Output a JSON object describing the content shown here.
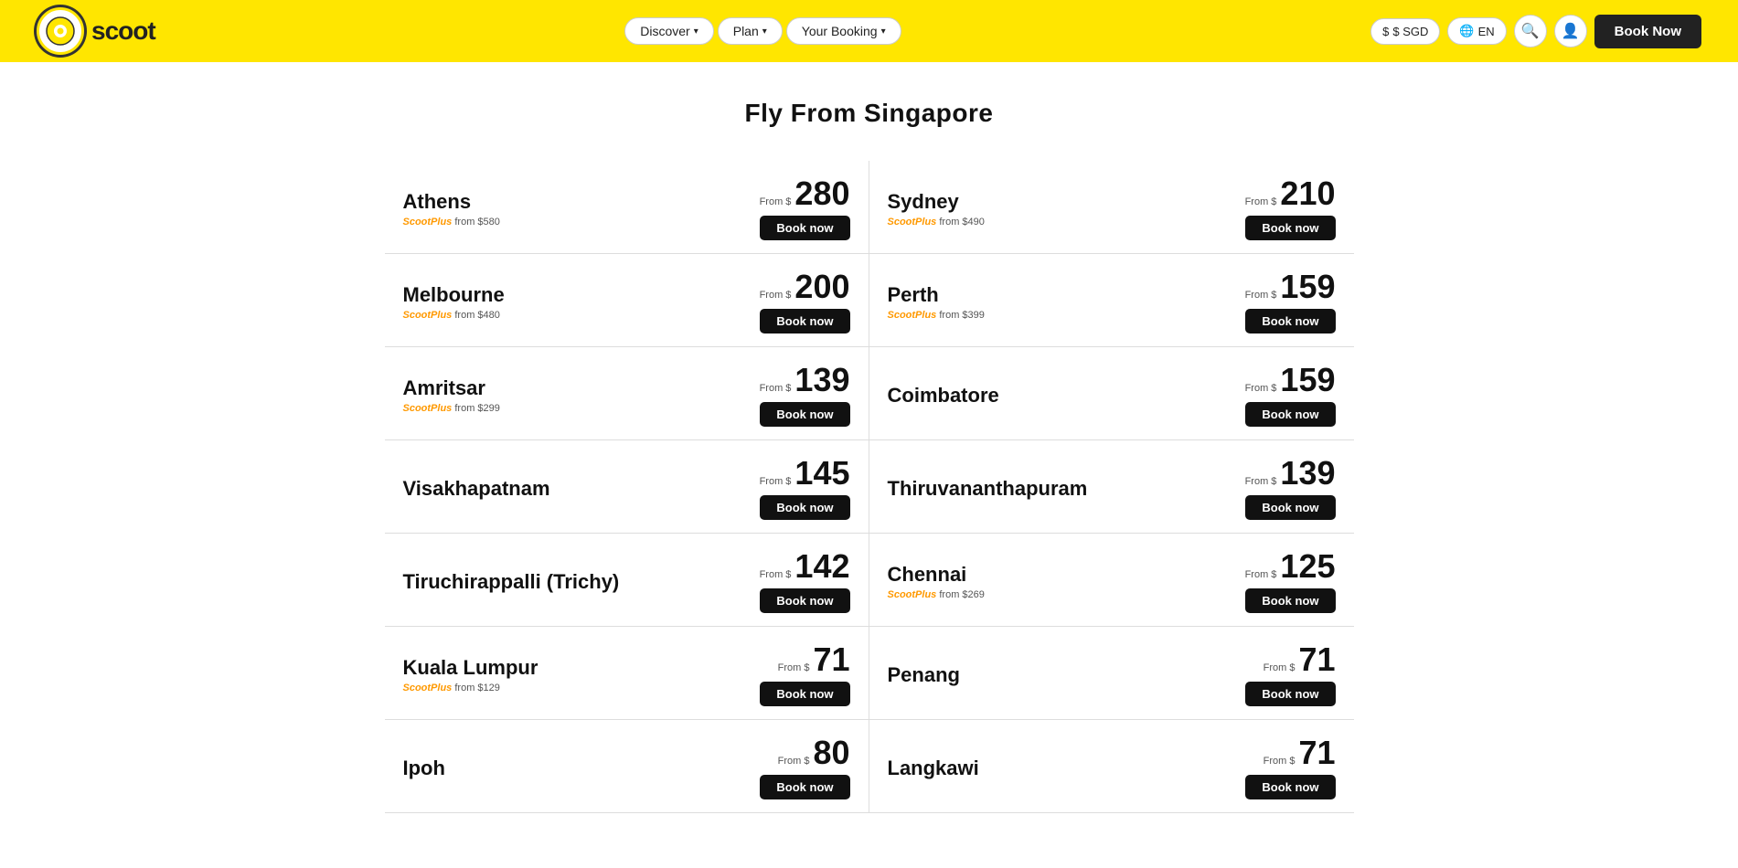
{
  "navbar": {
    "logo": "scoot",
    "nav_items": [
      {
        "label": "Discover",
        "has_arrow": true
      },
      {
        "label": "Plan",
        "has_arrow": true
      },
      {
        "label": "Your Booking",
        "has_arrow": true
      }
    ],
    "currency": "$ SGD",
    "language": "EN",
    "book_now": "Book Now"
  },
  "main": {
    "title": "Fly From Singapore",
    "destinations": [
      {
        "name": "Athens",
        "scootplus": "ScootPlus from $580",
        "from_label": "From $",
        "price": "280",
        "book_label": "Book now",
        "side": "left"
      },
      {
        "name": "Sydney",
        "scootplus": "ScootPlus from $490",
        "from_label": "From $",
        "price": "210",
        "book_label": "Book now",
        "side": "right"
      },
      {
        "name": "Melbourne",
        "scootplus": "ScootPlus from $480",
        "from_label": "From $",
        "price": "200",
        "book_label": "Book now",
        "side": "left"
      },
      {
        "name": "Perth",
        "scootplus": "ScootPlus from $399",
        "from_label": "From $",
        "price": "159",
        "book_label": "Book now",
        "side": "right"
      },
      {
        "name": "Amritsar",
        "scootplus": "ScootPlus from $299",
        "from_label": "From $",
        "price": "139",
        "book_label": "Book now",
        "side": "left"
      },
      {
        "name": "Coimbatore",
        "scootplus": "",
        "from_label": "From $",
        "price": "159",
        "book_label": "Book now",
        "side": "right"
      },
      {
        "name": "Visakhapatnam",
        "scootplus": "",
        "from_label": "From $",
        "price": "145",
        "book_label": "Book now",
        "side": "left"
      },
      {
        "name": "Thiruvananthapuram",
        "scootplus": "",
        "from_label": "From $",
        "price": "139",
        "book_label": "Book now",
        "side": "right"
      },
      {
        "name": "Tiruchirappalli (Trichy)",
        "scootplus": "",
        "from_label": "From $",
        "price": "142",
        "book_label": "Book now",
        "side": "left"
      },
      {
        "name": "Chennai",
        "scootplus": "ScootPlus from $269",
        "from_label": "From $",
        "price": "125",
        "book_label": "Book now",
        "side": "right"
      },
      {
        "name": "Kuala Lumpur",
        "scootplus": "ScootPlus from $129",
        "from_label": "From $",
        "price": "71",
        "book_label": "Book now",
        "side": "left"
      },
      {
        "name": "Penang",
        "scootplus": "",
        "from_label": "From $",
        "price": "71",
        "book_label": "Book now",
        "side": "right"
      },
      {
        "name": "Ipoh",
        "scootplus": "",
        "from_label": "From $",
        "price": "80",
        "book_label": "Book now",
        "side": "left"
      },
      {
        "name": "Langkawi",
        "scootplus": "",
        "from_label": "From $",
        "price": "71",
        "book_label": "Book now",
        "side": "right"
      }
    ]
  }
}
